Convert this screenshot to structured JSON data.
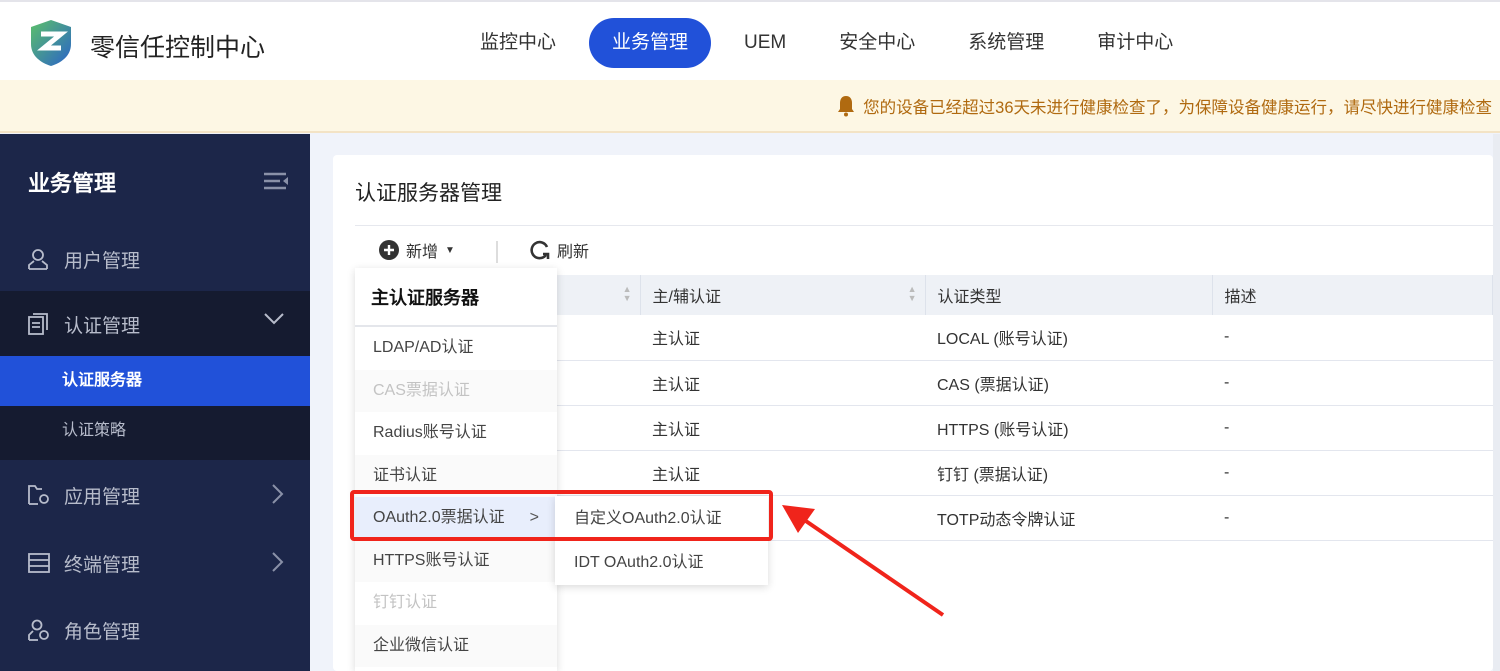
{
  "header": {
    "app_title": "零信任控制中心",
    "nav": [
      {
        "label": "监控中心"
      },
      {
        "label": "业务管理",
        "active": true
      },
      {
        "label": "UEM"
      },
      {
        "label": "安全中心"
      },
      {
        "label": "系统管理"
      },
      {
        "label": "审计中心"
      }
    ],
    "accent": "#2151d9"
  },
  "banner": {
    "icon": "bell-icon",
    "message": "您的设备已经超过36天未进行健康检查了，为保障设备健康运行，请尽快进行健康检查"
  },
  "sidebar": {
    "title": "业务管理",
    "items": [
      {
        "label": "用户管理",
        "icon": "user-icon"
      },
      {
        "label": "认证管理",
        "icon": "document-icon",
        "expanded": true,
        "children": [
          {
            "label": "认证服务器",
            "active": true
          },
          {
            "label": "认证策略"
          }
        ]
      },
      {
        "label": "应用管理",
        "icon": "folder-gear-icon"
      },
      {
        "label": "终端管理",
        "icon": "terminal-icon"
      },
      {
        "label": "角色管理",
        "icon": "role-icon"
      }
    ]
  },
  "main": {
    "title": "认证服务器管理",
    "toolbar": {
      "add_label": "新增",
      "refresh_label": "刷新"
    },
    "table": {
      "columns": [
        "",
        "主/辅认证",
        "认证类型",
        "描述"
      ],
      "rows": [
        [
          "主认证",
          "LOCAL (账号认证)",
          "-"
        ],
        [
          "主认证",
          "CAS (票据认证)",
          "-"
        ],
        [
          "主认证",
          "HTTPS (账号认证)",
          "-"
        ],
        [
          "主认证",
          "钉钉 (票据认证)",
          "-"
        ],
        [
          "",
          "TOTP动态令牌认证",
          "-"
        ]
      ]
    }
  },
  "dropdown": {
    "header": "主认证服务器",
    "items": [
      {
        "label": "LDAP/AD认证"
      },
      {
        "label": "CAS票据认证",
        "disabled": true
      },
      {
        "label": "Radius账号认证"
      },
      {
        "label": "证书认证"
      },
      {
        "label": "OAuth2.0票据认证",
        "submenu": true
      },
      {
        "label": "HTTPS账号认证"
      },
      {
        "label": "钉钉认证",
        "disabled": true
      },
      {
        "label": "企业微信认证"
      }
    ],
    "submenu": [
      {
        "label": "自定义OAuth2.0认证"
      },
      {
        "label": "IDT OAuth2.0认证"
      }
    ]
  },
  "annotation_color": "#f0241b"
}
